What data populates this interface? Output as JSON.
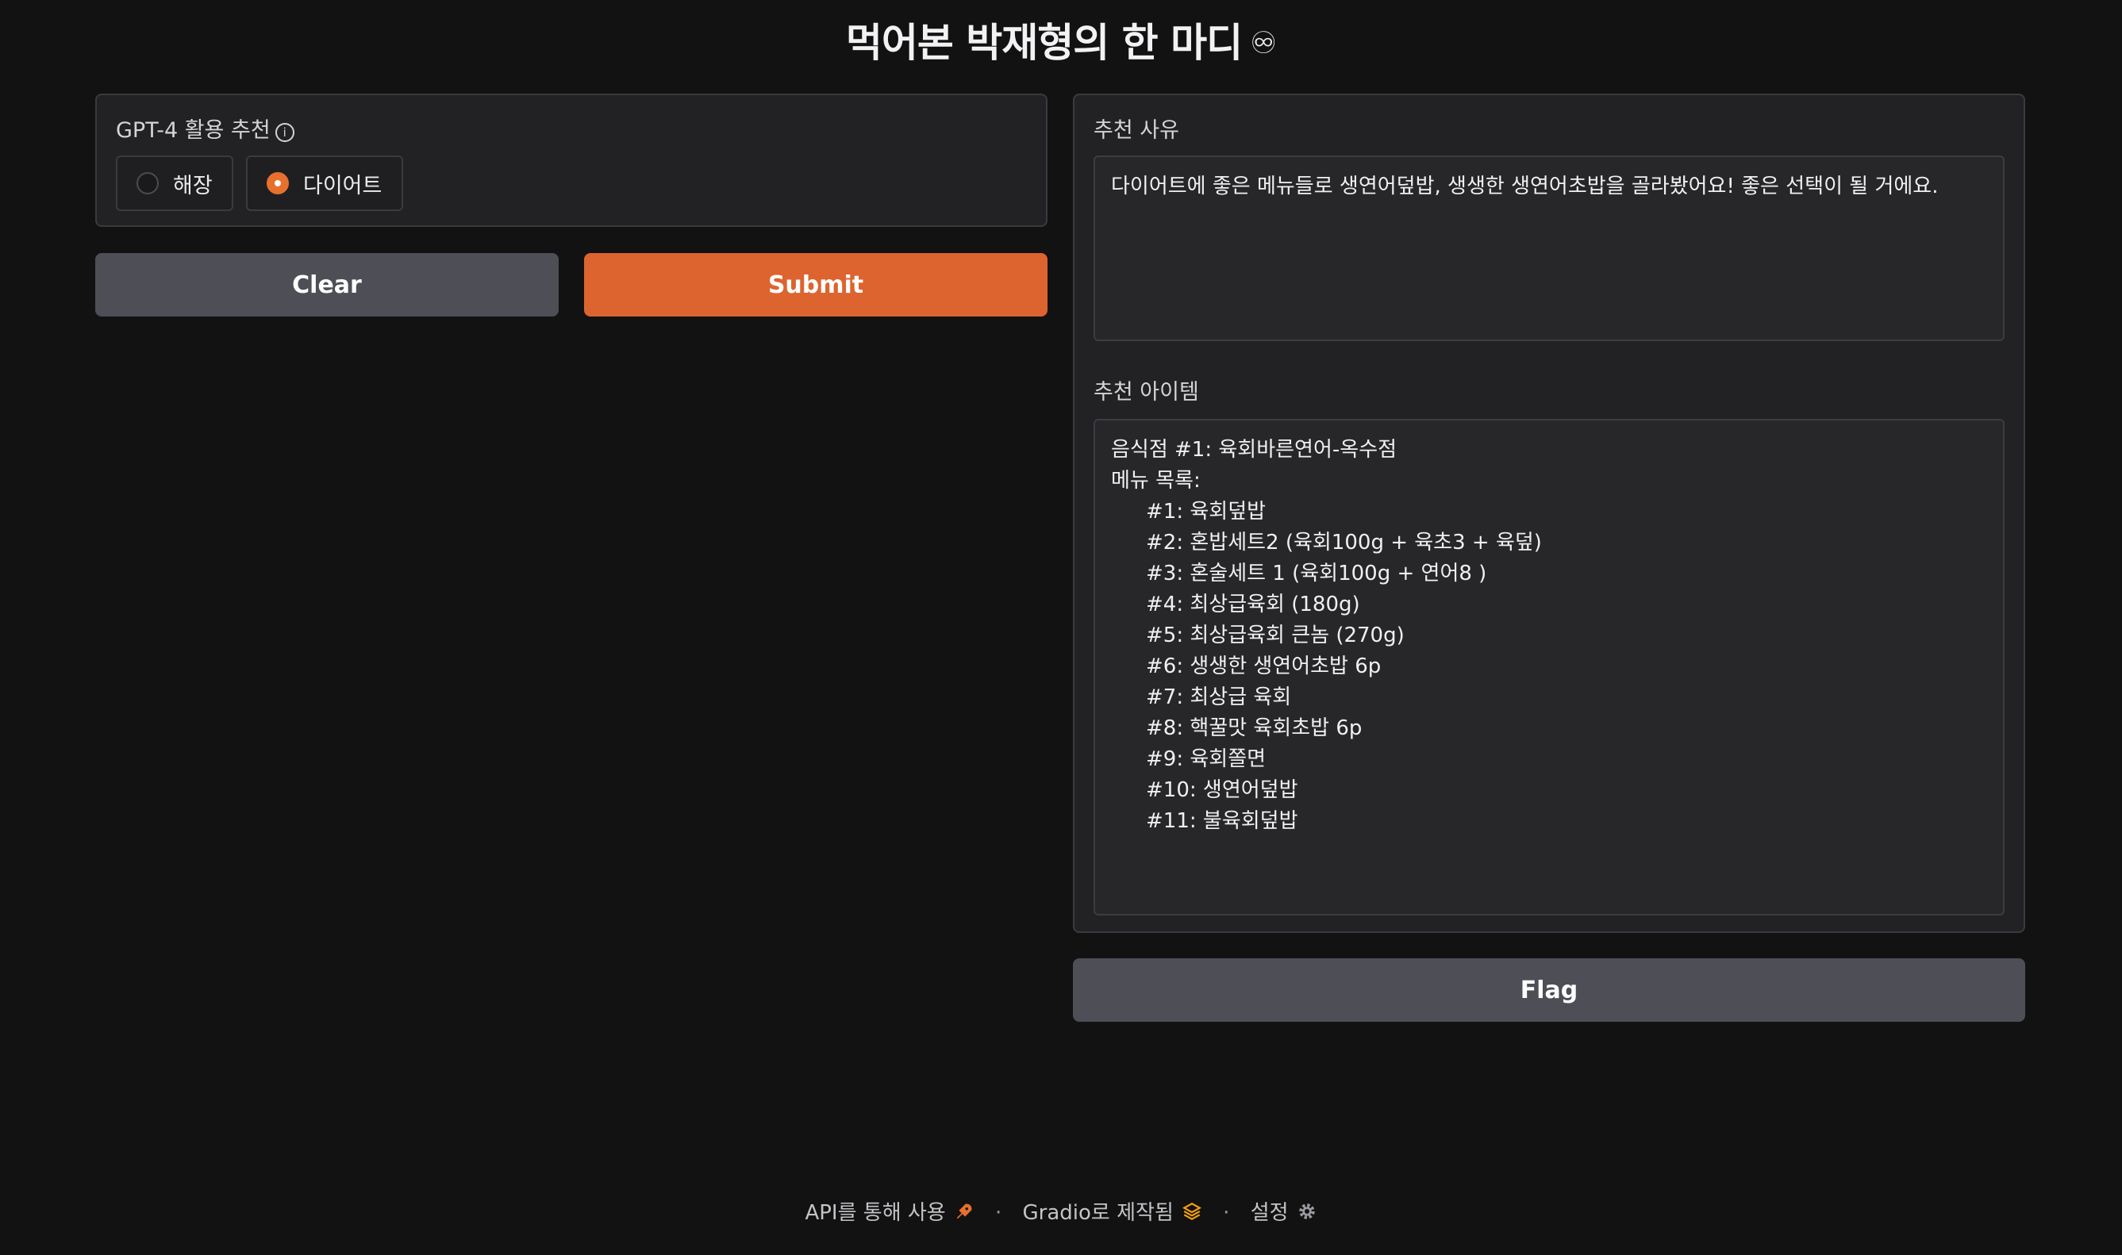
{
  "app": {
    "title": "먹어본 박재형의 한 마디",
    "title_icon": "infinity-glasses-icon"
  },
  "input_panel": {
    "label": "GPT-4 활용 추천",
    "info_icon": "info-icon",
    "options": [
      {
        "label": "해장",
        "selected": false
      },
      {
        "label": "다이어트",
        "selected": true
      }
    ]
  },
  "buttons": {
    "clear": "Clear",
    "submit": "Submit",
    "flag": "Flag"
  },
  "output_panel": {
    "reason_label": "추천 사유",
    "reason_text": "다이어트에 좋은 메뉴들로 생연어덮밥, 생생한 생연어초밥을 골라봤어요! 좋은 선택이 될 거에요.",
    "items_label": "추천 아이템",
    "restaurant_line": "음식점 #1: 육회바른연어-옥수점",
    "menu_header": "메뉴 목록:",
    "menu_items": [
      "#1: 육회덮밥",
      "#2: 혼밥세트2 (육회100g + 육초3 + 육덮)",
      "#3: 혼술세트 1 (육회100g + 연어8 )",
      "#4: 최상급육회 (180g)",
      "#5: 최상급육회 큰놈 (270g)",
      "#6: 생생한 생연어초밥 6p",
      "#7: 최상급 육회",
      "#8: 핵꿀맛 육회초밥 6p",
      "#9: 육회쫄면",
      "#10: 생연어덮밥",
      "#11: 불육회덮밥"
    ]
  },
  "footer": {
    "api_text": "API를 통해 사용",
    "api_icon": "rocket-icon",
    "built_text": "Gradio로 제작됨",
    "built_icon": "gradio-logo-icon",
    "settings_text": "설정",
    "settings_icon": "gear-icon",
    "separator": "·"
  },
  "colors": {
    "background": "#121212",
    "panel": "#222225",
    "accent": "#dd642f",
    "secondary_button": "#4d4e56"
  }
}
